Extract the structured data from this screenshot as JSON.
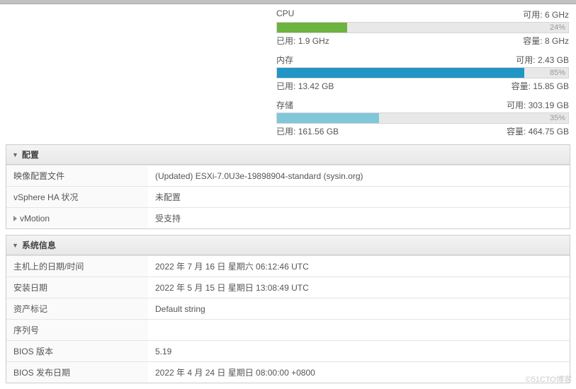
{
  "resources": {
    "cpu": {
      "label": "CPU",
      "free_label": "可用",
      "free": "6 GHz",
      "percent": 24,
      "used_label": "已用",
      "used": "1.9 GHz",
      "cap_label": "容量",
      "cap": "8 GHz"
    },
    "mem": {
      "label": "内存",
      "free_label": "可用",
      "free": "2.43 GB",
      "percent": 85,
      "used_label": "已用",
      "used": "13.42 GB",
      "cap_label": "容量",
      "cap": "15.85 GB"
    },
    "sto": {
      "label": "存储",
      "free_label": "可用",
      "free": "303.19 GB",
      "percent": 35,
      "used_label": "已用",
      "used": "161.56 GB",
      "cap_label": "容量",
      "cap": "464.75 GB"
    }
  },
  "config": {
    "title": "配置",
    "rows": {
      "image_profile": {
        "key": "映像配置文件",
        "val": "(Updated) ESXi-7.0U3e-19898904-standard (sysin.org)"
      },
      "ha": {
        "key": "vSphere HA 状况",
        "val": "未配置"
      },
      "vmotion": {
        "key": "vMotion",
        "val": "受支持"
      }
    }
  },
  "sysinfo": {
    "title": "系统信息",
    "rows": {
      "host_dt": {
        "key": "主机上的日期/时间",
        "val": "2022 年 7 月 16 日 星期六 06:12:46 UTC"
      },
      "install": {
        "key": "安装日期",
        "val": "2022 年 5 月 15 日 星期日 13:08:49 UTC"
      },
      "asset": {
        "key": "资产标记",
        "val": "Default string"
      },
      "serial": {
        "key": "序列号",
        "val": ""
      },
      "bios_ver": {
        "key": "BIOS 版本",
        "val": "5.19"
      },
      "bios_date": {
        "key": "BIOS 发布日期",
        "val": "2022 年 4 月 24 日 星期日 08:00:00 +0800"
      }
    }
  },
  "watermark": "©51CTO博客"
}
